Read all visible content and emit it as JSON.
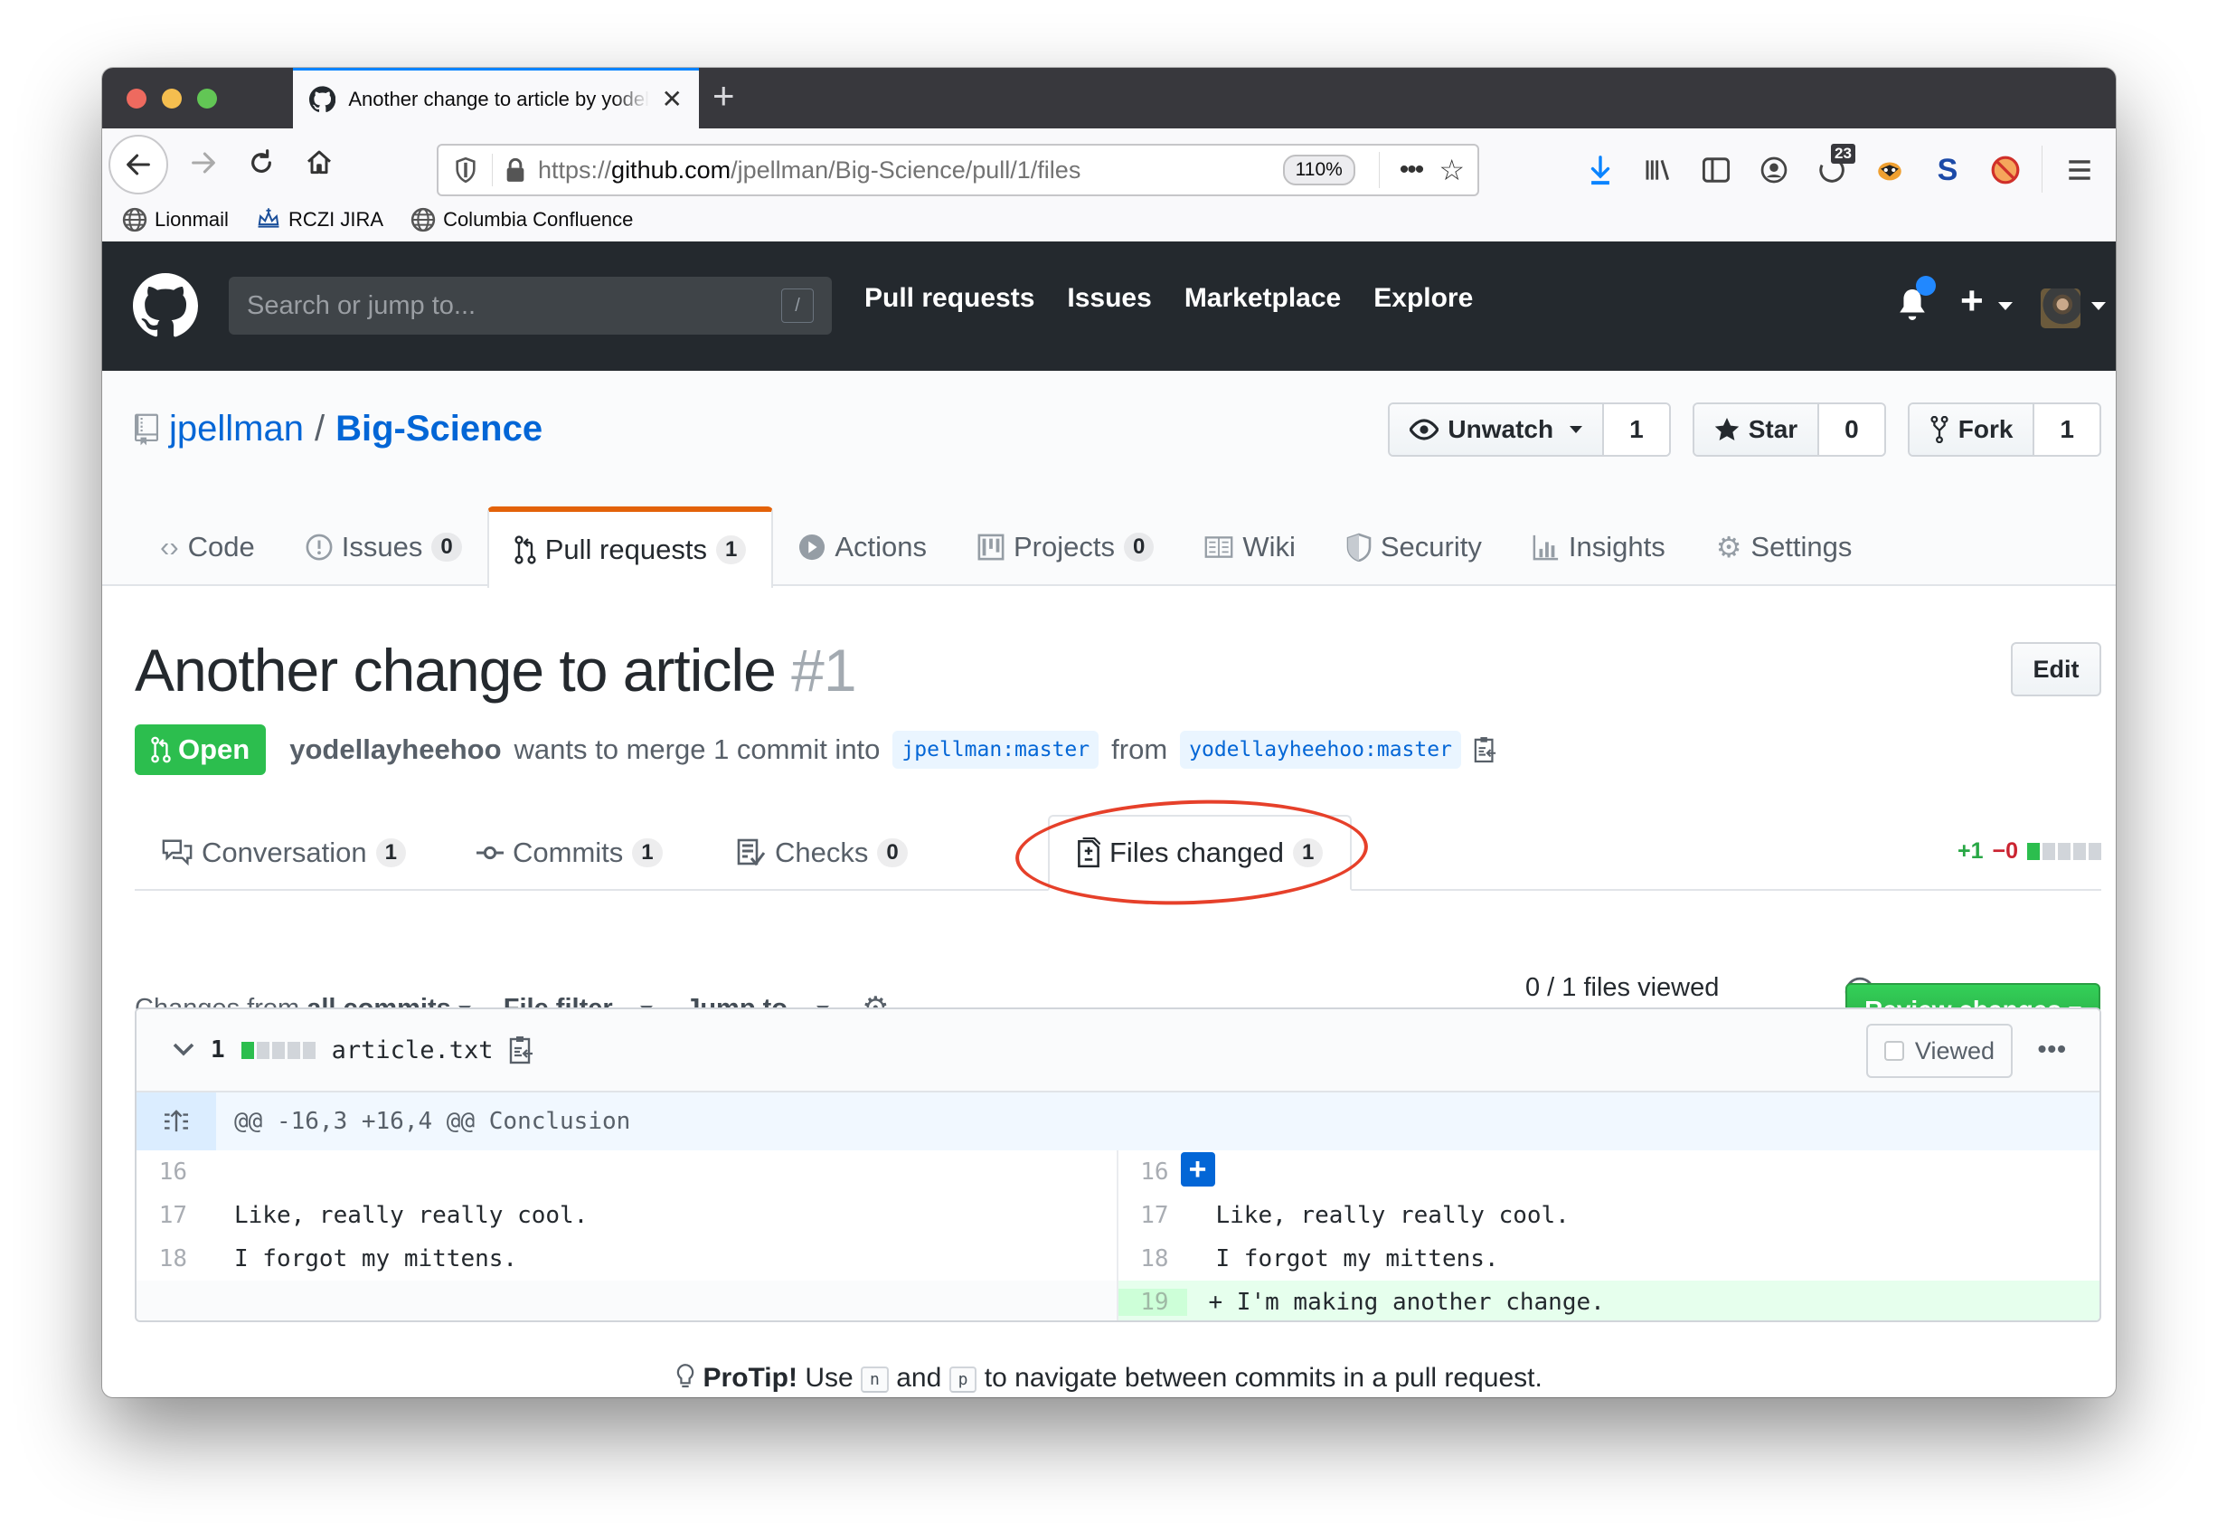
{
  "browser": {
    "tab_title": "Another change to article by yodellayheehoo",
    "new_tab_label": "+",
    "url_prefix": "https://",
    "url_host": "github.com",
    "url_path": "/jpellman/Big-Science/pull/1/files",
    "zoom_level": "110%",
    "downloads_badge": "23",
    "toolbar_icons": [
      "download-icon",
      "library-icon",
      "sidebar-icon",
      "account-icon",
      "timer-icon",
      "badger-icon",
      "s-extension-icon",
      "blocker-icon",
      "menu-icon"
    ],
    "bookmarks": [
      {
        "label": "Lionmail",
        "icon": "globe-icon"
      },
      {
        "label": "RCZI JIRA",
        "icon": "crown-icon"
      },
      {
        "label": "Columbia Confluence",
        "icon": "globe-icon"
      }
    ]
  },
  "github": {
    "search_placeholder": "Search or jump to...",
    "search_shortcut": "/",
    "nav": [
      "Pull requests",
      "Issues",
      "Marketplace",
      "Explore"
    ],
    "has_unread_notifications": true
  },
  "repo": {
    "owner": "jpellman",
    "separator": "/",
    "name": "Big-Science",
    "watch_label": "Unwatch",
    "watch_count": "1",
    "star_label": "Star",
    "star_count": "0",
    "fork_label": "Fork",
    "fork_count": "1",
    "nav": [
      {
        "label": "Code",
        "count": null,
        "icon": "code-icon"
      },
      {
        "label": "Issues",
        "count": "0",
        "icon": "issue-icon"
      },
      {
        "label": "Pull requests",
        "count": "1",
        "icon": "pull-request-icon",
        "selected": true
      },
      {
        "label": "Actions",
        "count": null,
        "icon": "play-icon"
      },
      {
        "label": "Projects",
        "count": "0",
        "icon": "project-icon"
      },
      {
        "label": "Wiki",
        "count": null,
        "icon": "book-icon"
      },
      {
        "label": "Security",
        "count": null,
        "icon": "shield-icon"
      },
      {
        "label": "Insights",
        "count": null,
        "icon": "graph-icon"
      },
      {
        "label": "Settings",
        "count": null,
        "icon": "gear-icon"
      }
    ]
  },
  "pr": {
    "title": "Another change to article",
    "number": "#1",
    "edit_label": "Edit",
    "state": "Open",
    "author": "yodellayheehoo",
    "merge_text": "wants to merge 1 commit into",
    "base_ref": "jpellman:master",
    "from_text": "from",
    "head_ref": "yodellayheehoo:master",
    "tabs": [
      {
        "label": "Conversation",
        "count": "1",
        "icon": "comment-icon"
      },
      {
        "label": "Commits",
        "count": "1",
        "icon": "commit-icon"
      },
      {
        "label": "Checks",
        "count": "0",
        "icon": "checklist-icon"
      },
      {
        "label": "Files changed",
        "count": "1",
        "icon": "file-diff-icon",
        "selected": true
      }
    ],
    "diffstat": {
      "additions": "+1",
      "deletions": "−0"
    },
    "toolbar": {
      "changes_from_prefix": "Changes from",
      "changes_from_value": "all commits",
      "file_filter": "File filter...",
      "jump_to": "Jump to..."
    },
    "files_viewed_text": "0 / 1 files viewed",
    "files_viewed_fraction": 0,
    "review_button": "Review changes"
  },
  "file": {
    "changes": "1",
    "name": "article.txt",
    "viewed_label": "Viewed",
    "viewed": false,
    "hunk_header": "@@ -16,3 +16,4 @@ Conclusion",
    "left_lines": [
      {
        "num": "16",
        "text": ""
      },
      {
        "num": "17",
        "text": "Like, really really cool."
      },
      {
        "num": "18",
        "text": "I forgot my mittens."
      }
    ],
    "right_lines": [
      {
        "num": "16",
        "text": ""
      },
      {
        "num": "17",
        "text": "Like, really really cool."
      },
      {
        "num": "18",
        "text": "I forgot my mittens."
      },
      {
        "num": "19",
        "text": "+ I'm making another change.",
        "type": "addition"
      }
    ]
  },
  "protip": {
    "label": "ProTip!",
    "before": "Use",
    "key1": "n",
    "middle": "and",
    "key2": "p",
    "after": "to navigate between commits in a pull request."
  }
}
